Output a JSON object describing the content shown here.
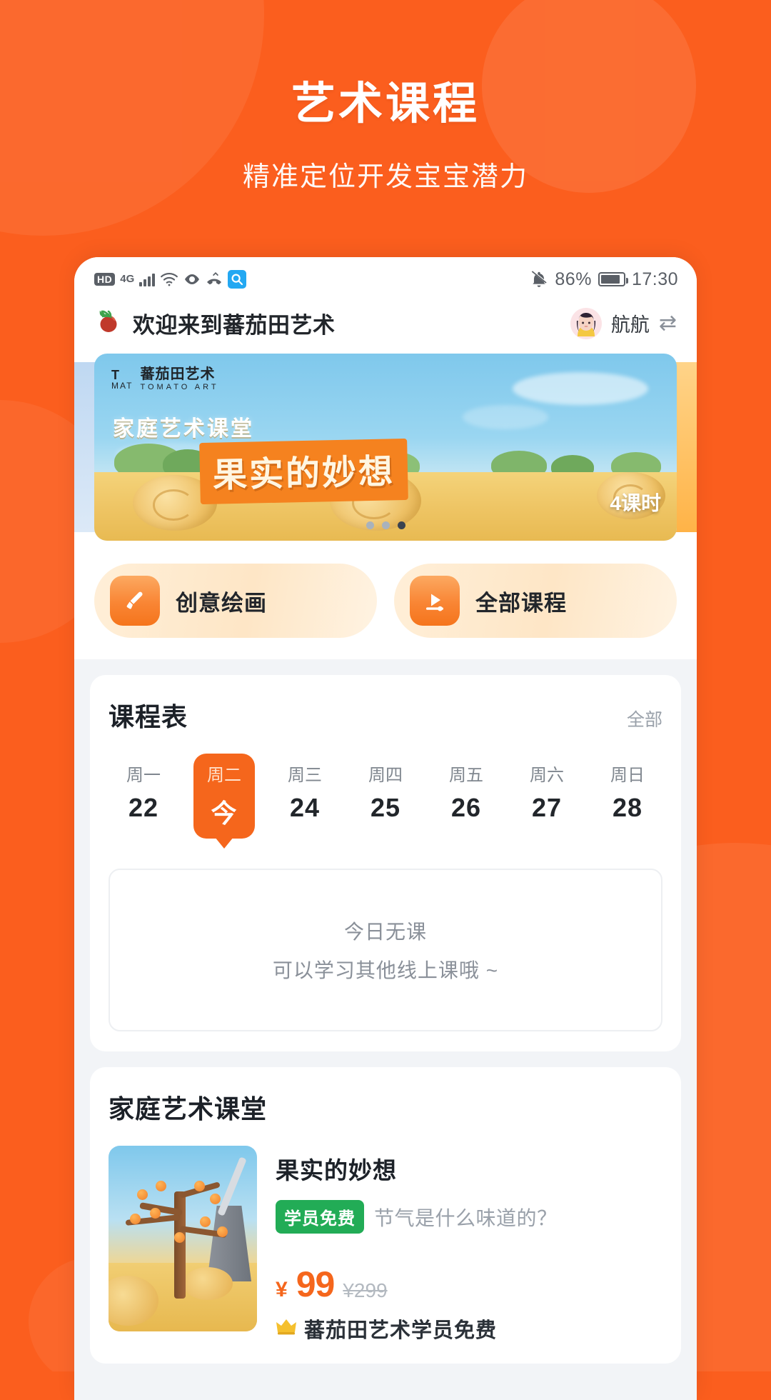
{
  "promo": {
    "title": "艺术课程",
    "subtitle": "精准定位开发宝宝潜力"
  },
  "statusbar": {
    "hd": "HD",
    "network": "4G",
    "battery_percent": "86%",
    "time": "17:30",
    "icons": [
      "hd-badge",
      "4g-label",
      "signal-bars-icon",
      "wifi-icon",
      "eye-icon",
      "missed-call-icon",
      "search-icon",
      "bell-muted-icon",
      "battery-icon"
    ]
  },
  "appbar": {
    "title": "欢迎来到蕃茄田艺术",
    "brand_icon": "tomato-icon",
    "user_name": "航航",
    "switch_icon": "⇄"
  },
  "banner": {
    "brand_cn": "蕃茄田艺术",
    "brand_en": "TOMATO ART",
    "logo_line1": "T",
    "logo_line2": "MAT",
    "kicker": "家庭艺术课堂",
    "title": "果实的妙想",
    "lessons": "4课时",
    "dots": 3,
    "active_dot": 2
  },
  "quick_actions": [
    {
      "label": "创意绘画",
      "icon": "paintbrush-icon"
    },
    {
      "label": "全部课程",
      "icon": "video-play-icon"
    }
  ],
  "schedule": {
    "title": "课程表",
    "action": "全部",
    "days": [
      {
        "dow": "周一",
        "num": "22",
        "active": false
      },
      {
        "dow": "周二",
        "num": "今",
        "active": true
      },
      {
        "dow": "周三",
        "num": "24",
        "active": false
      },
      {
        "dow": "周四",
        "num": "25",
        "active": false
      },
      {
        "dow": "周五",
        "num": "26",
        "active": false
      },
      {
        "dow": "周六",
        "num": "27",
        "active": false
      },
      {
        "dow": "周日",
        "num": "28",
        "active": false
      }
    ],
    "empty_line1": "今日无课",
    "empty_line2": "可以学习其他线上课哦 ~"
  },
  "family_class": {
    "title": "家庭艺术课堂",
    "course": {
      "name": "果实的妙想",
      "badge": "学员免费",
      "desc": "节气是什么味道的？",
      "currency": "¥",
      "price": "99",
      "old_price": "¥299",
      "free_note": "蕃茄田艺术学员免费",
      "free_icon": "crown-icon"
    }
  },
  "colors": {
    "brand_orange": "#FB5E1E",
    "accent_orange": "#F5661C",
    "badge_green": "#22AC56",
    "page_bg": "#F2F4F7"
  }
}
